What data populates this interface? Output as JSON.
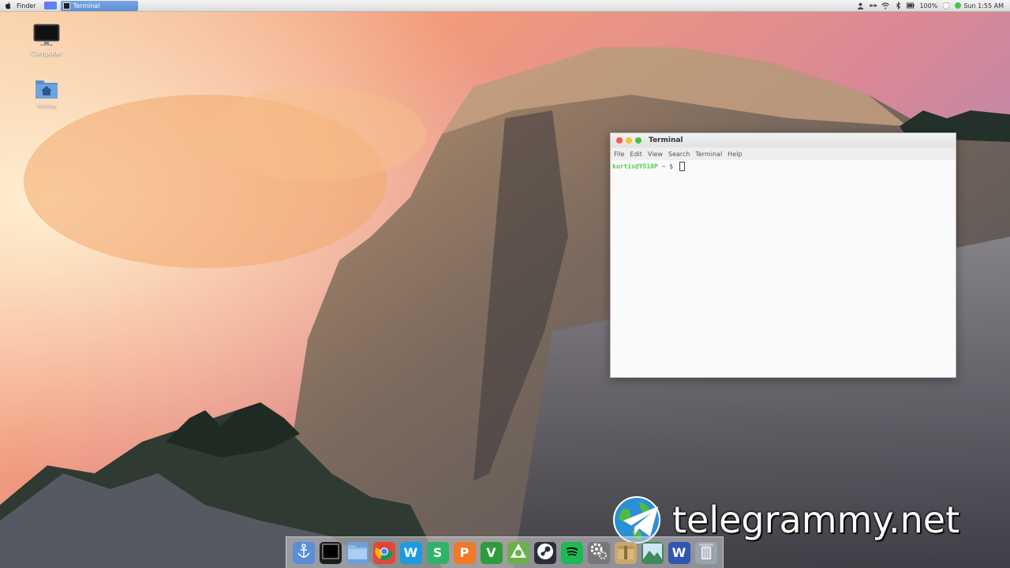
{
  "top_panel": {
    "app_menu": "Finder",
    "task_terminal": "Terminal",
    "battery": "100%",
    "clock": "Sun 1:55 AM"
  },
  "desktop_icons": [
    {
      "label": "Computer",
      "icon": "monitor-icon"
    },
    {
      "label": "Home",
      "icon": "home-folder-icon"
    }
  ],
  "terminal": {
    "title": "Terminal",
    "menu": [
      "File",
      "Edit",
      "View",
      "Search",
      "Terminal",
      "Help"
    ],
    "prompt_user": "kurtis@Y510P",
    "prompt_rest": "~ $"
  },
  "watermark": {
    "text": "telegrammy.net"
  },
  "dock": {
    "items": [
      {
        "name": "dock-launcher",
        "icon": "anchor-icon",
        "color": "#5a8fd8"
      },
      {
        "name": "dock-terminal",
        "icon": "terminal-icon",
        "color": "#1d1d1d"
      },
      {
        "name": "dock-files",
        "icon": "folder-icon",
        "color": "#6f9fd8"
      },
      {
        "name": "dock-chrome",
        "icon": "chrome-icon",
        "color": "#e8453c"
      },
      {
        "name": "dock-writer",
        "icon": "writer-icon",
        "color": "#1e9be0",
        "letter": "W"
      },
      {
        "name": "dock-spreadsheet",
        "icon": "spreadsheet-icon",
        "color": "#2fb36b",
        "letter": "S"
      },
      {
        "name": "dock-presentation",
        "icon": "presentation-icon",
        "color": "#f07a28",
        "letter": "P"
      },
      {
        "name": "dock-vim",
        "icon": "vim-icon",
        "color": "#2d9c3a",
        "letter": "V"
      },
      {
        "name": "dock-android-studio",
        "icon": "android-icon",
        "color": "#6bb04a"
      },
      {
        "name": "dock-steam",
        "icon": "steam-icon",
        "color": "#2a2f3a"
      },
      {
        "name": "dock-spotify",
        "icon": "spotify-icon",
        "color": "#1db954"
      },
      {
        "name": "dock-settings",
        "icon": "gears-icon",
        "color": "#777777"
      },
      {
        "name": "dock-archive",
        "icon": "archive-icon",
        "color": "#c9a86a"
      },
      {
        "name": "dock-image-viewer",
        "icon": "image-icon",
        "color": "#3e8a5a"
      },
      {
        "name": "dock-word-doc",
        "icon": "document-icon",
        "color": "#2f56b0",
        "letter": "W"
      },
      {
        "name": "dock-trash",
        "icon": "trash-icon",
        "color": "#9aa4ad"
      }
    ]
  }
}
